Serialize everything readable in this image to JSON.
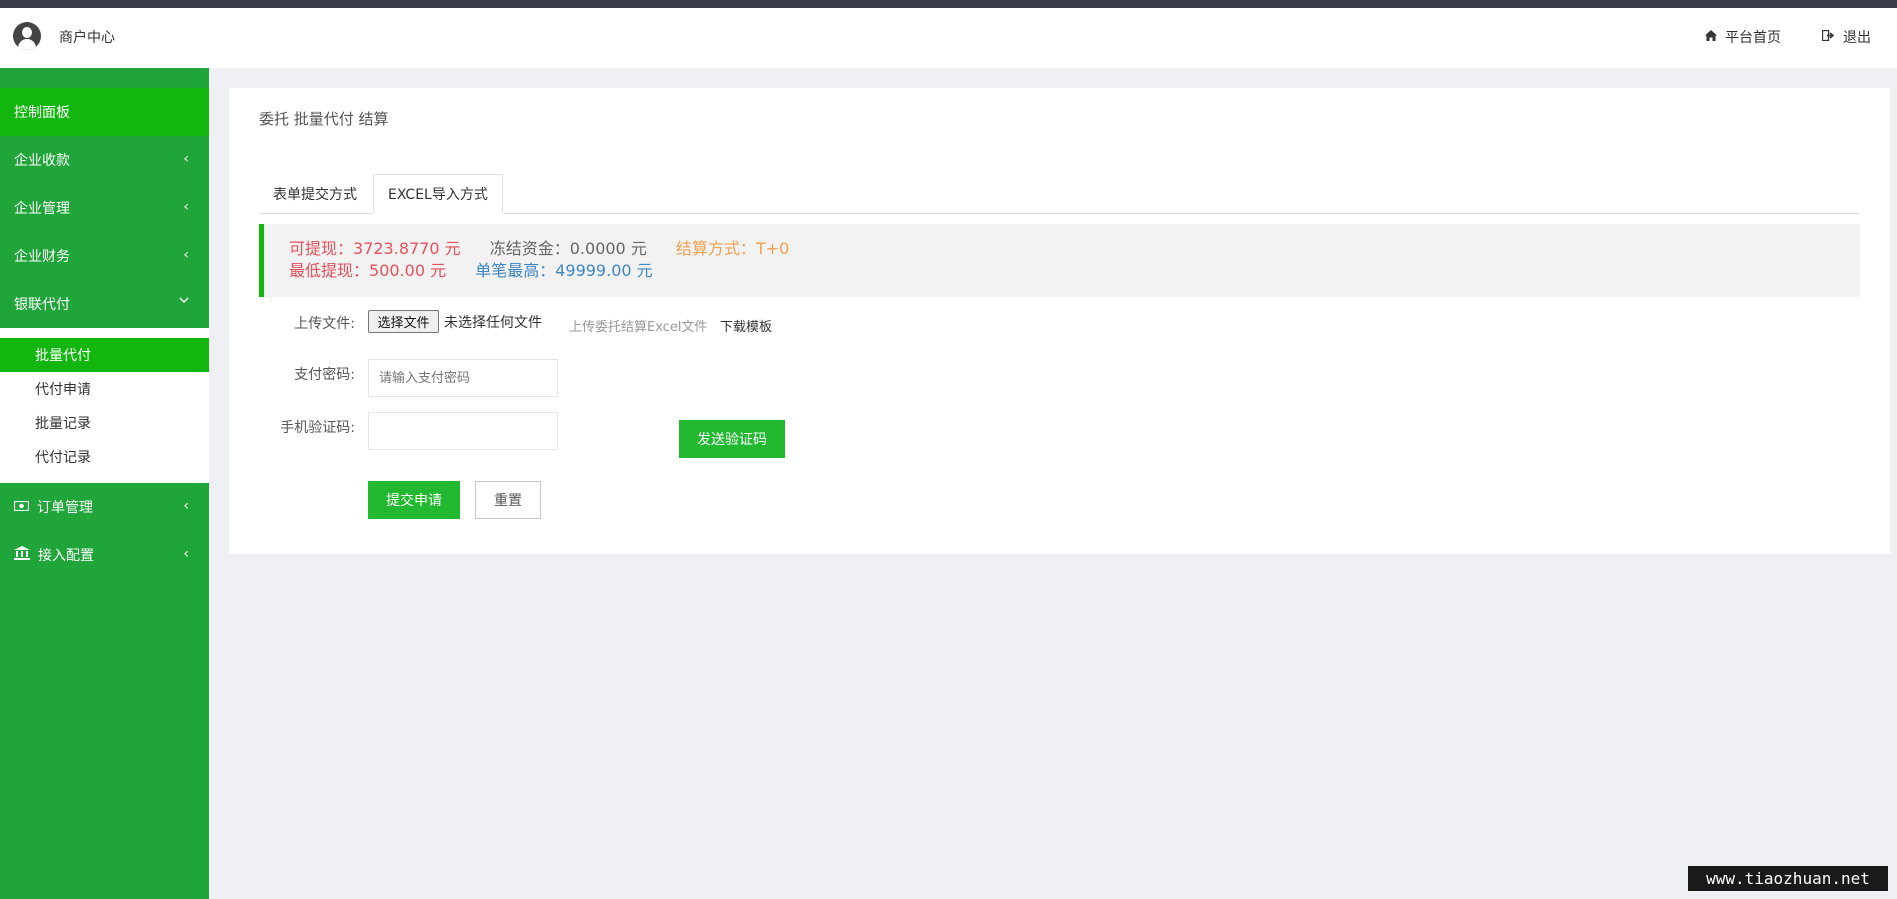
{
  "header": {
    "brand": "商户中心",
    "home_link": "平台首页",
    "logout_link": "退出"
  },
  "sidebar": {
    "items": [
      {
        "label": "控制面板"
      },
      {
        "label": "企业收款"
      },
      {
        "label": "企业管理"
      },
      {
        "label": "企业财务"
      },
      {
        "label": "银联代付"
      },
      {
        "label": "订单管理"
      },
      {
        "label": "接入配置"
      }
    ],
    "submenu": [
      {
        "label": "批量代付"
      },
      {
        "label": "代付申请"
      },
      {
        "label": "批量记录"
      },
      {
        "label": "代付记录"
      }
    ]
  },
  "main": {
    "breadcrumb": "委托 批量代付 结算",
    "tabs": [
      {
        "label": "表单提交方式"
      },
      {
        "label": "EXCEL导入方式"
      }
    ],
    "notice": {
      "available_label": "可提现：",
      "available_value": "3723.8770 元",
      "frozen_label": "冻结资金：",
      "frozen_value": "0.0000 元",
      "settlement_label": "结算方式：",
      "settlement_value": "T+0",
      "min_label": "最低提现：",
      "min_value": "500.00 元",
      "max_label": "单笔最高：",
      "max_value": "49999.00 元"
    },
    "form": {
      "upload_label": "上传文件:",
      "choose_file_button": "选择文件",
      "file_status": "未选择任何文件",
      "upload_hint": "上传委托结算Excel文件",
      "download_template": "下载模板",
      "password_label": "支付密码:",
      "password_placeholder": "请输入支付密码",
      "sms_label": "手机验证码:",
      "sms_value": "",
      "send_code_button": "发送验证码",
      "submit_button": "提交申请",
      "reset_button": "重置"
    }
  },
  "watermark": "www.tiaozhuan.net",
  "colors": {
    "sidebar_bg": "#20a53a",
    "active_green": "#13b50f",
    "button_green": "#22b930",
    "available_red": "#e8505b",
    "settlement_orange": "#f0a050",
    "max_blue": "#3e86c6"
  }
}
